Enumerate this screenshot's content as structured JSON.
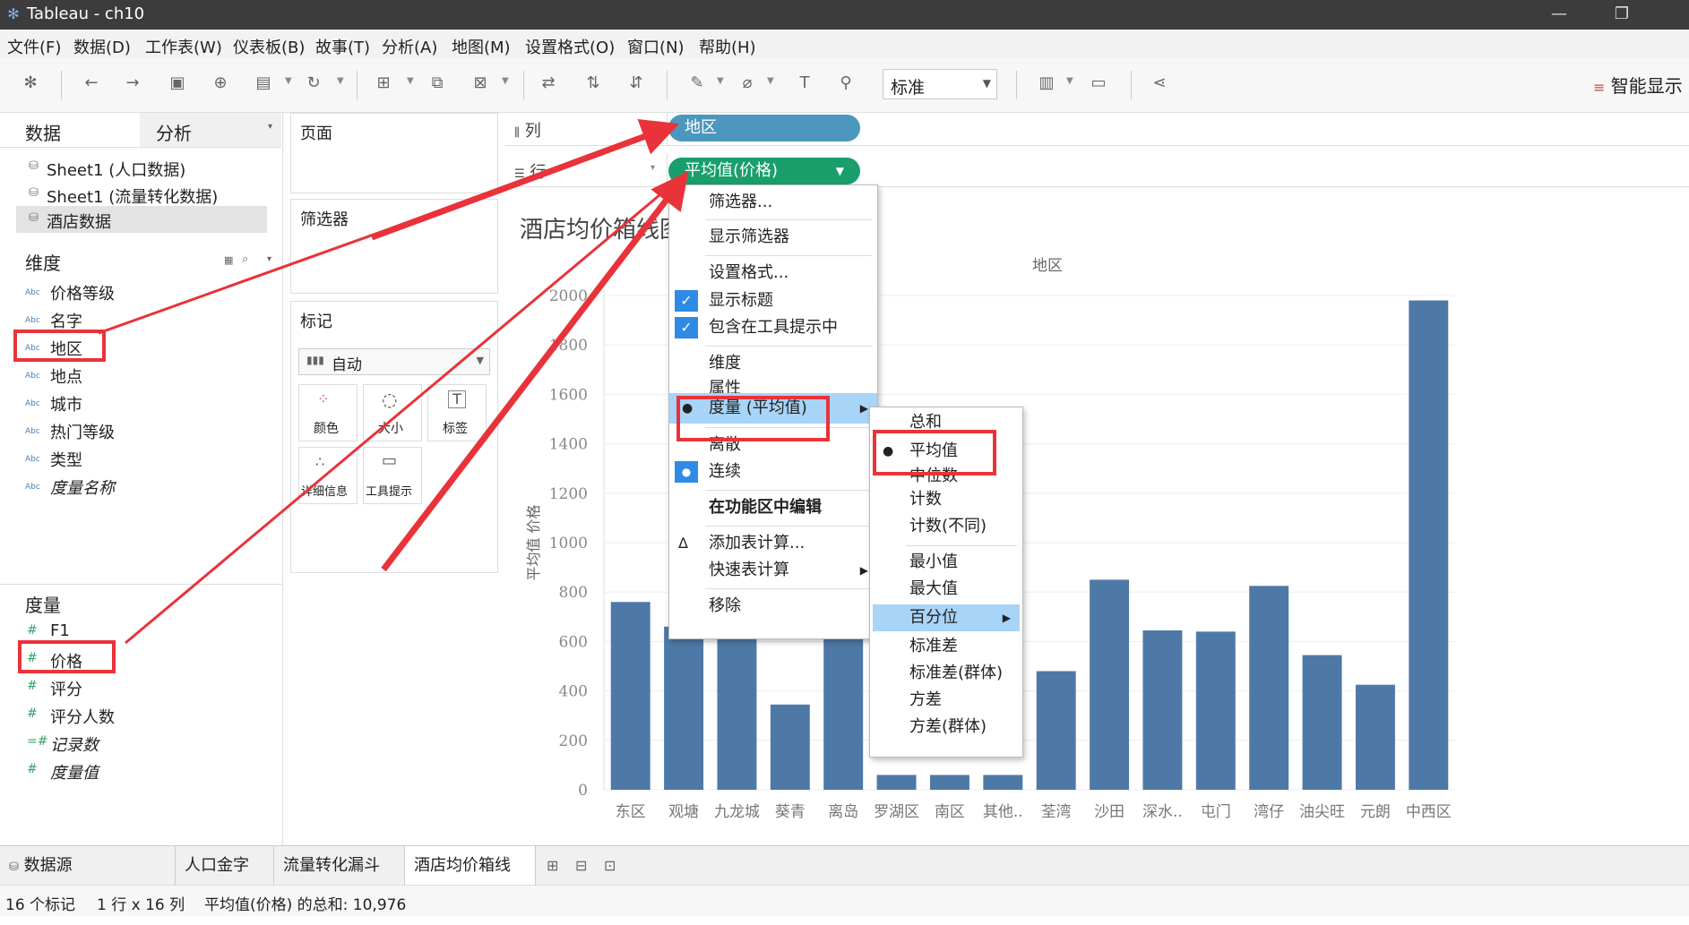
{
  "app": {
    "title": "Tableau - ch10"
  },
  "menu": [
    "文件(F)",
    "数据(D)",
    "工作表(W)",
    "仪表板(B)",
    "故事(T)",
    "分析(A)",
    "地图(M)",
    "设置格式(O)",
    "窗口(N)",
    "帮助(H)"
  ],
  "toolbar": {
    "fit_value": "标准",
    "smart_show": "智能显示"
  },
  "data_pane": {
    "tab_data": "数据",
    "tab_analysis": "分析",
    "sources": [
      "Sheet1 (人口数据)",
      "Sheet1 (流量转化数据)",
      "酒店数据"
    ],
    "dimensions_title": "维度",
    "dimensions": [
      {
        "name": "价格等级",
        "italic": false
      },
      {
        "name": "名字",
        "italic": false
      },
      {
        "name": "地区",
        "italic": false
      },
      {
        "name": "地点",
        "italic": false
      },
      {
        "name": "城市",
        "italic": false
      },
      {
        "name": "热门等级",
        "italic": false
      },
      {
        "name": "类型",
        "italic": false
      },
      {
        "name": "度量名称",
        "italic": true
      }
    ],
    "measures_title": "度量",
    "measures": [
      {
        "name": "F1",
        "italic": false
      },
      {
        "name": "价格",
        "italic": false
      },
      {
        "name": "评分",
        "italic": false
      },
      {
        "name": "评分人数",
        "italic": false
      },
      {
        "name": "记录数",
        "italic": true
      },
      {
        "name": "度量值",
        "italic": true
      }
    ]
  },
  "pages_card": {
    "title": "页面"
  },
  "filters_card": {
    "title": "筛选器"
  },
  "marks_card": {
    "title": "标记",
    "type": "自动",
    "buttons": [
      "颜色",
      "大小",
      "标签",
      "详细信息",
      "工具提示"
    ]
  },
  "shelves": {
    "columns_label": "列",
    "rows_label": "行",
    "columns_pill": "地区",
    "rows_pill": "平均值(价格)"
  },
  "context_menu": {
    "items": [
      "筛选器...",
      "显示筛选器",
      "设置格式...",
      "显示标题",
      "包含在工具提示中",
      "维度",
      "属性",
      "度量 (平均值)",
      "离散",
      "连续",
      "在功能区中编辑",
      "添加表计算...",
      "快速表计算",
      "移除"
    ]
  },
  "sub_menu": {
    "items": [
      "总和",
      "平均值",
      "中位数",
      "计数",
      "计数(不同)",
      "最小值",
      "最大值",
      "百分位",
      "标准差",
      "标准差(群体)",
      "方差",
      "方差(群体)"
    ]
  },
  "sheet_tabs": {
    "datasource": "数据源",
    "tabs": [
      "人口金字塔",
      "流量转化漏斗图",
      "酒店均价箱线图"
    ]
  },
  "status": {
    "marks": "16 个标记",
    "dims": "1 行 x 16 列",
    "sum": "平均值(价格) 的总和: 10,976"
  },
  "chart_data": {
    "type": "bar",
    "title": "酒店均价箱线图",
    "xlabel": "地区",
    "ylabel": "平均值 价格",
    "ylim": [
      0,
      2000
    ],
    "yticks": [
      0,
      200,
      400,
      600,
      800,
      1000,
      1200,
      1400,
      1600,
      1800,
      2000
    ],
    "categories": [
      "东区",
      "观塘",
      "九龙城",
      "葵青",
      "离岛",
      "罗湖区",
      "南区",
      "其他..",
      "荃湾",
      "沙田",
      "深水..",
      "屯门",
      "湾仔",
      "油尖旺",
      "元朗",
      "中西区"
    ],
    "values": [
      760,
      660,
      640,
      345,
      660,
      60,
      60,
      60,
      480,
      850,
      645,
      640,
      825,
      545,
      425,
      1980
    ],
    "color": "#4e79a7"
  },
  "colors": {
    "pill_blue": "#4b97be",
    "pill_green": "#1a9e6c",
    "highlight_red": "#e8333a",
    "menu_highlight": "#a8d4f8"
  }
}
